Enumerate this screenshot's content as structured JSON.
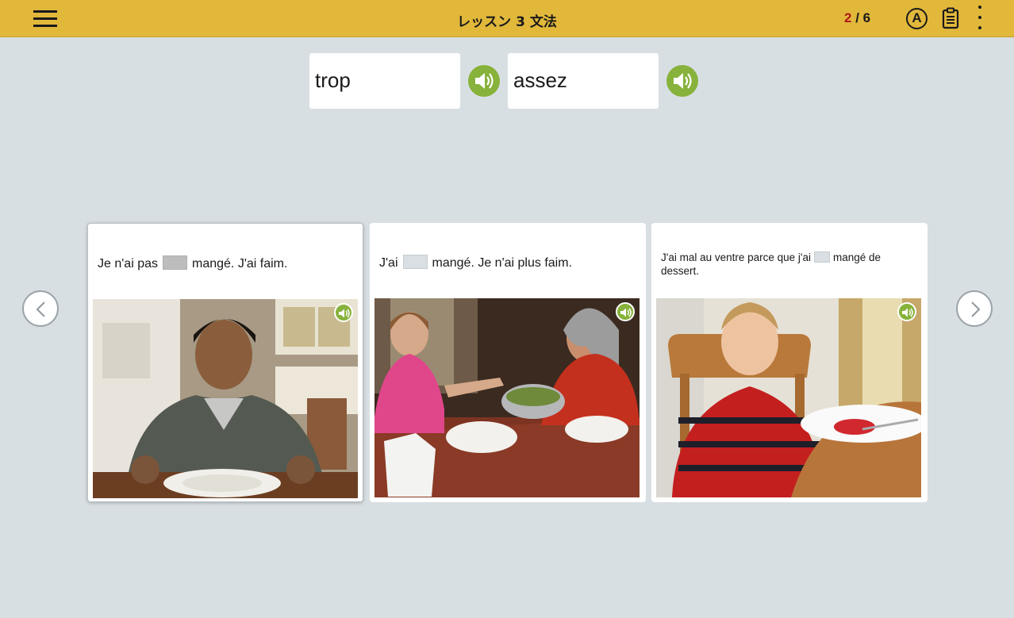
{
  "header": {
    "title": "レッスン 3 文法",
    "progress_current": "2",
    "progress_sep": " / ",
    "progress_total": "6",
    "answer_icon_letter": "A"
  },
  "words": [
    {
      "text": "trop"
    },
    {
      "text": "assez"
    }
  ],
  "cards": [
    {
      "before": "Je n'ai pas",
      "after": "mangé. J'ai faim.",
      "blank_state": "filled",
      "selected": true
    },
    {
      "before": "J'ai",
      "after": "mangé. Je n'ai plus faim.",
      "blank_state": "empty",
      "selected": false
    },
    {
      "before": "J'ai mal au ventre parce que j'ai",
      "after": "mangé de dessert.",
      "blank_state": "empty",
      "selected": false
    }
  ],
  "icons": {
    "menu": "hamburger-menu-icon",
    "answer": "circled-a-icon",
    "clipboard": "clipboard-icon",
    "more": "vertical-dots-icon",
    "speaker": "speaker-icon",
    "prev": "chevron-left-icon",
    "next": "chevron-right-icon"
  },
  "colors": {
    "topbar": "#e2b83b",
    "background": "#d8dfe3",
    "audio_green": "#87b23b",
    "progress_current": "#b01818"
  }
}
